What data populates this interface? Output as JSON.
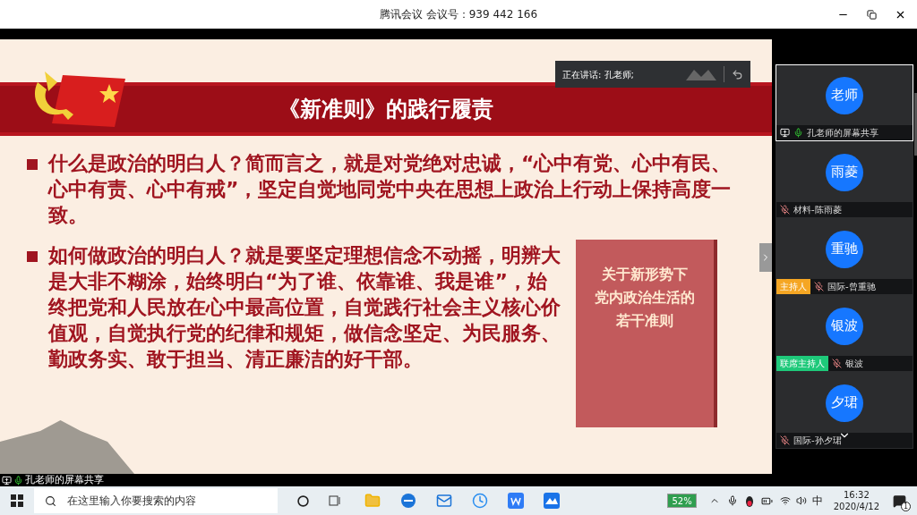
{
  "window": {
    "title": "腾讯会议 会议号：939 442 166"
  },
  "speaking": {
    "label": "正在讲话: 孔老师;"
  },
  "slide": {
    "title": "《新准则》的践行履责",
    "bullets": [
      "什么是政治的明白人？简而言之，就是对党绝对忠诚，“心中有党、心中有民、心中有责、心中有戒”，坚定自觉地同党中央在思想上政治上行动上保持高度一致。",
      "如何做政治的明白人？就是要坚定理想信念不动摇，明辨大是大非不糊涂，始终明白“为了谁、依靠谁、我是谁”，始终把党和人民放在心中最高位置，自觉践行社会主义核心价值观，自觉执行党的纪律和规矩，做信念坚定、为民服务、勤政务实、敢于担当、清正廉洁的好干部。"
    ],
    "book_lines": [
      "关于新形势下",
      "党内政治生活的",
      "若干准则"
    ]
  },
  "share_label": "孔老师的屏幕共享",
  "participants": [
    {
      "avatar": "老师",
      "name": "孔老师的屏幕共享",
      "selected": true,
      "muted": false,
      "sharing": true
    },
    {
      "avatar": "雨菱",
      "name": "材料-陈雨菱",
      "selected": false,
      "muted": true,
      "sharing": false
    },
    {
      "avatar": "重驰",
      "name": "国际-曾重驰",
      "selected": false,
      "muted": true,
      "sharing": false,
      "role": "主持人",
      "color": "#f5a623"
    },
    {
      "avatar": "银波",
      "name": "银波",
      "selected": false,
      "muted": true,
      "sharing": false,
      "role": "联席主持人",
      "color": "#1ec97a"
    },
    {
      "avatar": "夕珺",
      "name": "国际-孙夕珺",
      "selected": false,
      "muted": true,
      "sharing": false
    }
  ],
  "taskbar": {
    "search_placeholder": "在这里输入你要搜索的内容",
    "battery": "52%",
    "ime": "中",
    "time": "16:32",
    "date": "2020/4/12",
    "notifications": "1"
  }
}
